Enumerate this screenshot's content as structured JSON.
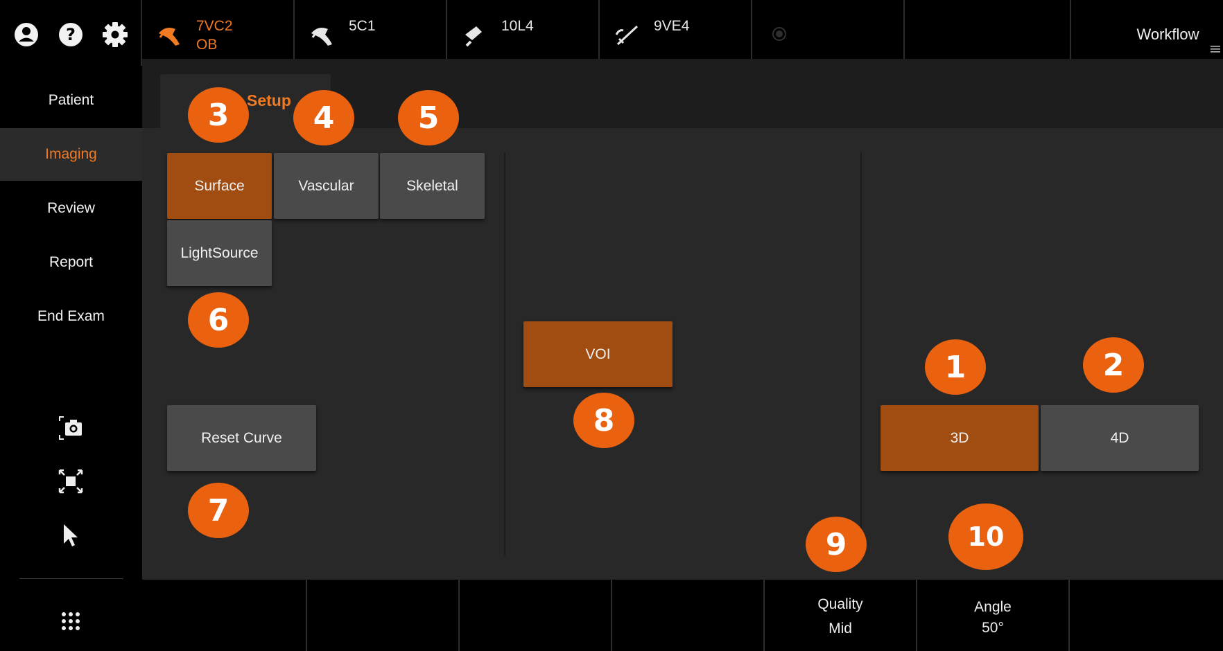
{
  "top_icons": [
    {
      "name": "user-icon"
    },
    {
      "name": "help-icon"
    },
    {
      "name": "gear-icon"
    }
  ],
  "nav": {
    "items": [
      {
        "label": "Patient",
        "active": false
      },
      {
        "label": "Imaging",
        "active": true
      },
      {
        "label": "Review",
        "active": false
      },
      {
        "label": "Report",
        "active": false
      },
      {
        "label": "End Exam",
        "active": false
      }
    ]
  },
  "side_tools": [
    "camera-icon",
    "fullscreen-icon",
    "pointer-icon",
    "apps-grid-icon"
  ],
  "transducers": [
    {
      "name": "7VC2",
      "preset": "OB",
      "active": true
    },
    {
      "name": "5C1",
      "preset": "",
      "active": false
    },
    {
      "name": "10L4",
      "preset": "",
      "active": false
    },
    {
      "name": "9VE4",
      "preset": "",
      "active": false
    }
  ],
  "workflow_label": "Workflow",
  "tab": {
    "label": "Setup"
  },
  "buttons": {
    "surface": "Surface",
    "vascular": "Vascular",
    "skeletal": "Skeletal",
    "lightsource": "LightSource",
    "reset_curve": "Reset Curve",
    "voi": "VOI",
    "mode_3d": "3D",
    "mode_4d": "4D"
  },
  "badges": {
    "b1": "1",
    "b2": "2",
    "b3": "3",
    "b4": "4",
    "b5": "5",
    "b6": "6",
    "b7": "7",
    "b8": "8",
    "b9": "9",
    "b10": "10"
  },
  "bottom": {
    "quality": {
      "label": "Quality",
      "value": "Mid"
    },
    "angle": {
      "label": "Angle",
      "value": "50°"
    }
  },
  "colors": {
    "accent": "#f07b22",
    "active_button": "#a14c10",
    "badge": "#ea6210",
    "inactive_button": "#4a4a4a"
  }
}
